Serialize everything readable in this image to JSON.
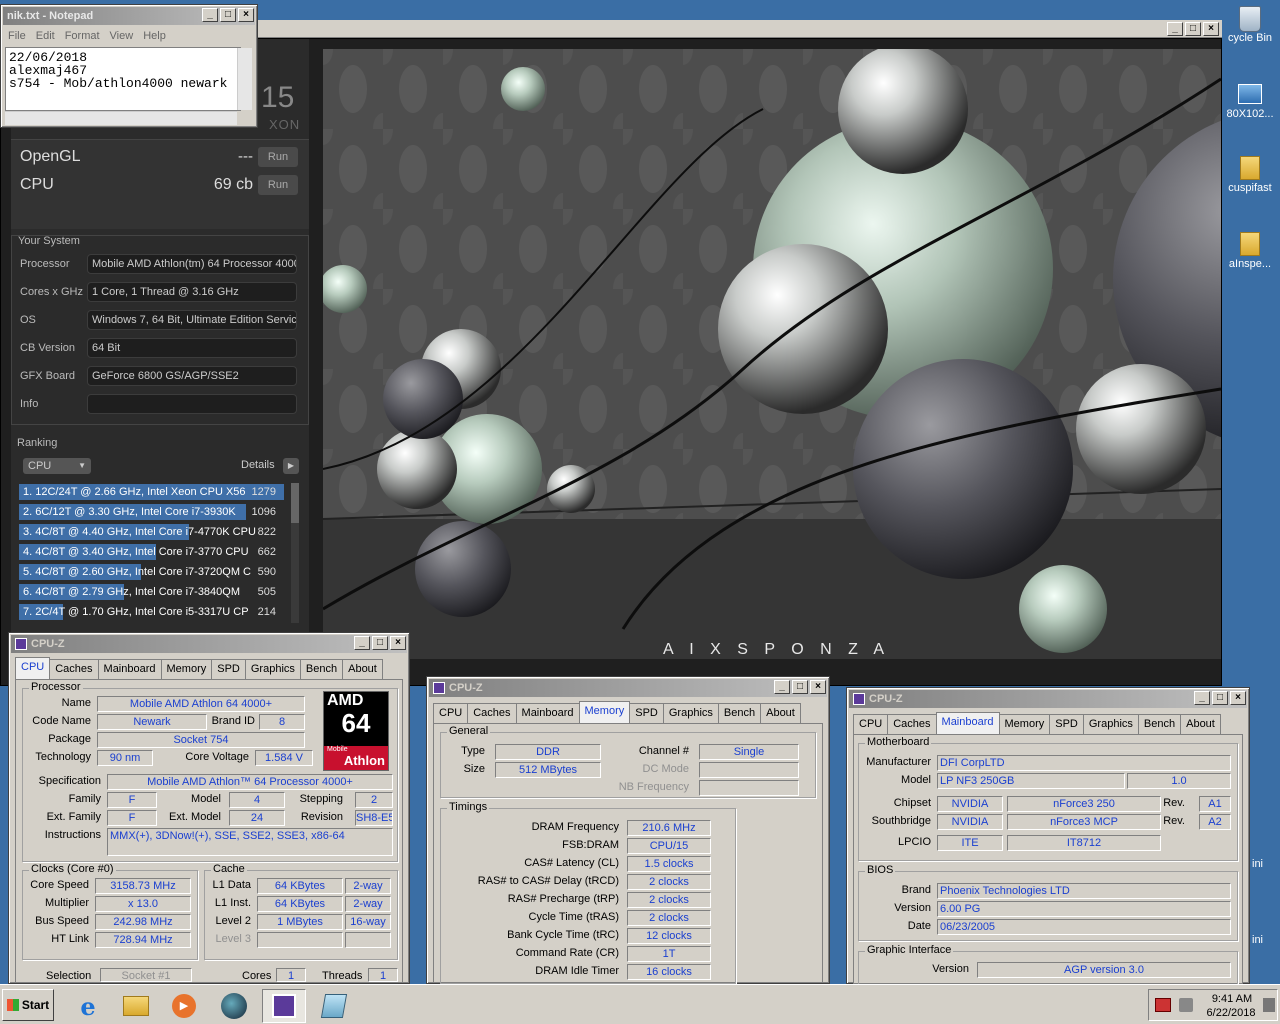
{
  "desktop": {
    "icons": [
      {
        "label": "cycle Bin",
        "icon": "recycle-bin-icon"
      },
      {
        "label": "80X102...",
        "icon": "image-file-icon"
      },
      {
        "label": "cuspifast",
        "icon": "folder-icon"
      },
      {
        "label": "aInspe...",
        "icon": "folder-icon"
      }
    ],
    "edge_labels": [
      "ini",
      "ini"
    ]
  },
  "notepad": {
    "title": "nik.txt - Notepad",
    "menu": [
      "File",
      "Edit",
      "Format",
      "View",
      "Help"
    ],
    "lines": [
      "22/06/2018",
      "alexmaj467",
      "s754 - Mob/athlon4000 newark"
    ]
  },
  "cinebench": {
    "title_fragment": "15",
    "subtitle_fragment": "XON",
    "opengl_label": "OpenGL",
    "opengl_score": "---",
    "cpu_label": "CPU",
    "cpu_score": "69 cb",
    "run_label": "Run",
    "your_system_title": "Your System",
    "system": [
      {
        "label": "Processor",
        "value": "Mobile AMD Athlon(tm) 64 Processor 4000+"
      },
      {
        "label": "Cores x GHz",
        "value": "1 Core, 1 Thread @ 3.16 GHz"
      },
      {
        "label": "OS",
        "value": "Windows 7, 64 Bit, Ultimate Edition Service"
      },
      {
        "label": "CB Version",
        "value": "64 Bit"
      },
      {
        "label": "GFX Board",
        "value": "GeForce 6800 GS/AGP/SSE2"
      },
      {
        "label": "Info",
        "value": ""
      }
    ],
    "ranking_title": "Ranking",
    "ranking_dropdown": "CPU",
    "details_label": "Details",
    "ranking": [
      {
        "text": "1. 12C/24T @ 2.66 GHz, Intel Xeon CPU X56",
        "score": "1279",
        "fill": 1.0
      },
      {
        "text": "2. 6C/12T @ 3.30 GHz,  Intel Core i7-3930K",
        "score": "1096",
        "fill": 0.857
      },
      {
        "text": "3. 4C/8T @ 4.40 GHz, Intel Core i7-4770K CPU",
        "score": "822",
        "fill": 0.643
      },
      {
        "text": "4. 4C/8T @ 3.40 GHz,  Intel Core i7-3770 CPU",
        "score": "662",
        "fill": 0.518
      },
      {
        "text": "5. 4C/8T @ 2.60 GHz, Intel Core i7-3720QM C",
        "score": "590",
        "fill": 0.461
      },
      {
        "text": "6. 4C/8T @ 2.79 GHz,  Intel Core i7-3840QM",
        "score": "505",
        "fill": 0.395
      },
      {
        "text": "7. 2C/4T @ 1.70 GHz,  Intel Core i5-3317U CP",
        "score": "214",
        "fill": 0.167
      }
    ],
    "watermark": "A I X S P O N Z A"
  },
  "cpuz1": {
    "title": "CPU-Z",
    "tabs": [
      "CPU",
      "Caches",
      "Mainboard",
      "Memory",
      "SPD",
      "Graphics",
      "Bench",
      "About"
    ],
    "active_tab": "CPU",
    "processor_group": "Processor",
    "name_label": "Name",
    "name": "Mobile AMD Athlon 64 4000+",
    "codename_label": "Code Name",
    "codename": "Newark",
    "brandid_label": "Brand ID",
    "brandid": "8",
    "package_label": "Package",
    "package": "Socket 754",
    "technology_label": "Technology",
    "technology": "90 nm",
    "corevoltage_label": "Core Voltage",
    "corevoltage": "1.584 V",
    "spec_label": "Specification",
    "spec": "Mobile AMD Athlon™ 64 Processor 4000+",
    "family_label": "Family",
    "family": "F",
    "model_label": "Model",
    "model": "4",
    "stepping_label": "Stepping",
    "stepping": "2",
    "extfamily_label": "Ext. Family",
    "extfamily": "F",
    "extmodel_label": "Ext. Model",
    "extmodel": "24",
    "revision_label": "Revision",
    "revision": "SH8-E5",
    "instructions_label": "Instructions",
    "instructions": "MMX(+), 3DNow!(+), SSE, SSE2, SSE3, x86-64",
    "clocks_group": "Clocks (Core #0)",
    "corespeed_label": "Core Speed",
    "corespeed": "3158.73 MHz",
    "multiplier_label": "Multiplier",
    "multiplier": "x 13.0",
    "busspeed_label": "Bus Speed",
    "busspeed": "242.98 MHz",
    "htlink_label": "HT Link",
    "htlink": "728.94 MHz",
    "cache_group": "Cache",
    "l1data_label": "L1 Data",
    "l1data": "64 KBytes",
    "l1data_way": "2-way",
    "l1inst_label": "L1 Inst.",
    "l1inst": "64 KBytes",
    "l1inst_way": "2-way",
    "level2_label": "Level 2",
    "level2": "1 MBytes",
    "level2_way": "16-way",
    "level3_label": "Level 3",
    "selection_label": "Selection",
    "selection": "Socket #1",
    "cores_label": "Cores",
    "cores": "1",
    "threads_label": "Threads",
    "threads": "1",
    "logo_amd": "AMD",
    "logo_64": "64",
    "logo_mobile": "Mobile",
    "logo_athlon": "Athlon"
  },
  "cpuz2": {
    "title": "CPU-Z",
    "tabs": [
      "CPU",
      "Caches",
      "Mainboard",
      "Memory",
      "SPD",
      "Graphics",
      "Bench",
      "About"
    ],
    "active_tab": "Memory",
    "general_group": "General",
    "type_label": "Type",
    "type": "DDR",
    "channel_label": "Channel #",
    "channel": "Single",
    "size_label": "Size",
    "size": "512 MBytes",
    "dcmode_label": "DC Mode",
    "nbfreq_label": "NB Frequency",
    "timings_group": "Timings",
    "timings": [
      {
        "label": "DRAM Frequency",
        "value": "210.6 MHz"
      },
      {
        "label": "FSB:DRAM",
        "value": "CPU/15"
      },
      {
        "label": "CAS# Latency (CL)",
        "value": "1.5 clocks"
      },
      {
        "label": "RAS# to CAS# Delay (tRCD)",
        "value": "2 clocks"
      },
      {
        "label": "RAS# Precharge (tRP)",
        "value": "2 clocks"
      },
      {
        "label": "Cycle Time (tRAS)",
        "value": "2 clocks"
      },
      {
        "label": "Bank Cycle Time (tRC)",
        "value": "12 clocks"
      },
      {
        "label": "Command Rate (CR)",
        "value": "1T"
      },
      {
        "label": "DRAM Idle Timer",
        "value": "16 clocks"
      }
    ]
  },
  "cpuz3": {
    "title": "CPU-Z",
    "tabs": [
      "CPU",
      "Caches",
      "Mainboard",
      "Memory",
      "SPD",
      "Graphics",
      "Bench",
      "About"
    ],
    "active_tab": "Mainboard",
    "motherboard_group": "Motherboard",
    "manufacturer_label": "Manufacturer",
    "manufacturer": "DFI CorpLTD",
    "model_label": "Model",
    "model": "LP NF3 250GB",
    "model_rev": "1.0",
    "chipset_label": "Chipset",
    "chipset_vendor": "NVIDIA",
    "chipset": "nForce3 250",
    "chipset_rev_label": "Rev.",
    "chipset_rev": "A1",
    "southbridge_label": "Southbridge",
    "sb_vendor": "NVIDIA",
    "southbridge": "nForce3 MCP",
    "sb_rev_label": "Rev.",
    "sb_rev": "A2",
    "lpcio_label": "LPCIO",
    "lpcio_vendor": "ITE",
    "lpcio": "IT8712",
    "bios_group": "BIOS",
    "brand_label": "Brand",
    "brand": "Phoenix Technologies LTD",
    "version_label": "Version",
    "version": "6.00 PG",
    "date_label": "Date",
    "date": "06/23/2005",
    "graphic_group": "Graphic Interface",
    "gversion_label": "Version",
    "gversion": "AGP version 3.0"
  },
  "taskbar": {
    "start_label": "Start",
    "time": "9:41 AM",
    "date": "6/22/2018"
  }
}
